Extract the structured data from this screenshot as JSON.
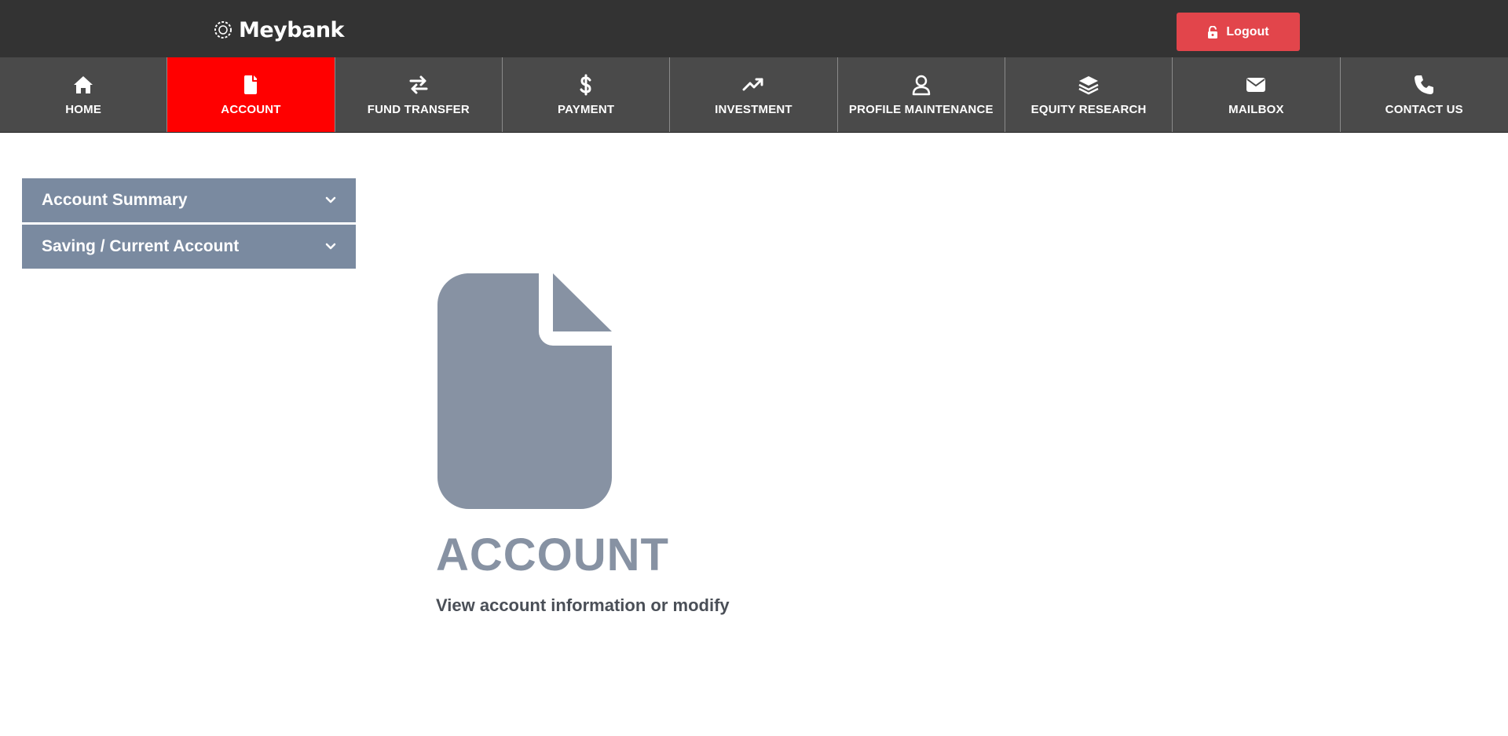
{
  "header": {
    "brand": "Meybank",
    "logout_label": "Logout"
  },
  "nav": {
    "items": [
      {
        "label": "HOME",
        "icon": "home-icon"
      },
      {
        "label": "ACCOUNT",
        "icon": "file-icon",
        "active": true
      },
      {
        "label": "FUND TRANSFER",
        "icon": "transfer-arrows-icon"
      },
      {
        "label": "PAYMENT",
        "icon": "dollar-icon"
      },
      {
        "label": "INVESTMENT",
        "icon": "trend-up-icon"
      },
      {
        "label": "PROFILE MAINTENANCE",
        "icon": "user-icon"
      },
      {
        "label": "EQUITY RESEARCH",
        "icon": "layers-icon"
      },
      {
        "label": "MAILBOX",
        "icon": "envelope-icon"
      },
      {
        "label": "CONTACT US",
        "icon": "phone-icon"
      }
    ]
  },
  "sidebar": {
    "items": [
      {
        "label": "Account Summary"
      },
      {
        "label": "Saving / Current Account"
      }
    ]
  },
  "main": {
    "title": "ACCOUNT",
    "subtitle": "View account information or modify",
    "icon": "file-icon"
  },
  "colors": {
    "topbar": "#333333",
    "nav": "#4a4a4a",
    "active": "#ff0000",
    "logout": "#e2454b",
    "sidebar": "#7a8aa0",
    "hero": "#8792a3"
  }
}
